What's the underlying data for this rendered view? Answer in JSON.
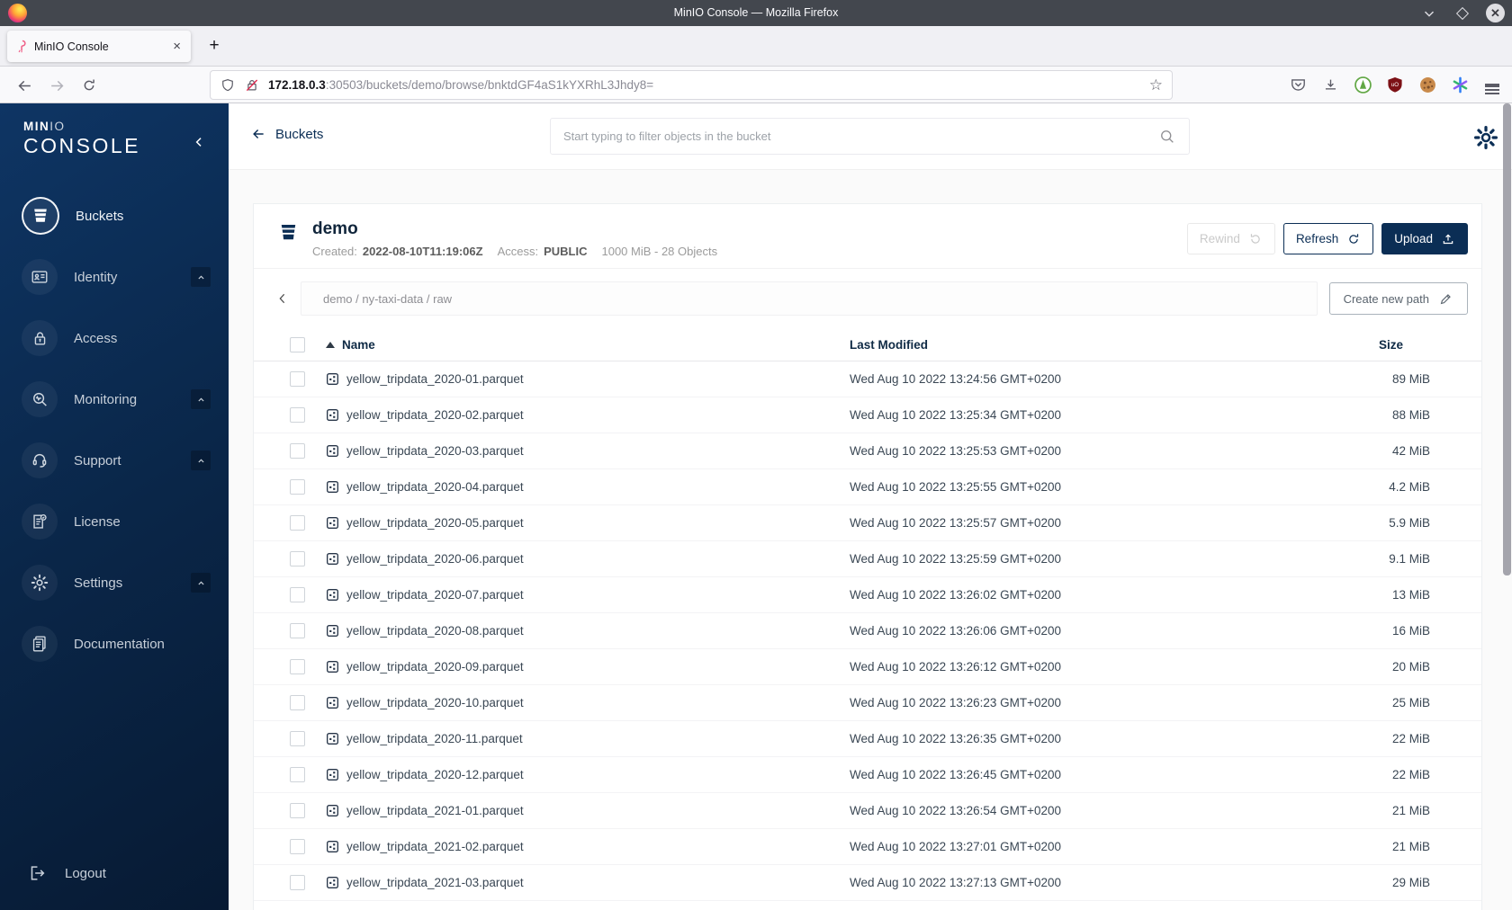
{
  "titlebar": {
    "title": "MinIO Console — Mozilla Firefox"
  },
  "tabs": {
    "active_tab": "MinIO Console",
    "close_glyph": "×",
    "new_tab_label": "+"
  },
  "urlbar": {
    "host": "172.18.0.3",
    "path": ":30503/buckets/demo/browse/bnktdGF4aS1kYXRhL3Jhdy8=",
    "star_glyph": "☆"
  },
  "sidebar": {
    "brand_min": "MIN",
    "brand_io": "IO",
    "brand_console": "CONSOLE",
    "items": [
      {
        "label": "Buckets",
        "icon": "bucket",
        "active": true,
        "expandable": false
      },
      {
        "label": "Identity",
        "icon": "identity",
        "active": false,
        "expandable": true
      },
      {
        "label": "Access",
        "icon": "access",
        "active": false,
        "expandable": false
      },
      {
        "label": "Monitoring",
        "icon": "monitoring",
        "active": false,
        "expandable": true
      },
      {
        "label": "Support",
        "icon": "support",
        "active": false,
        "expandable": true
      },
      {
        "label": "License",
        "icon": "license",
        "active": false,
        "expandable": false
      },
      {
        "label": "Settings",
        "icon": "settings",
        "active": false,
        "expandable": true
      },
      {
        "label": "Documentation",
        "icon": "documentation",
        "active": false,
        "expandable": false
      }
    ],
    "logout": {
      "label": "Logout"
    }
  },
  "topbar": {
    "back_label": "Buckets",
    "search_placeholder": "Start typing to filter objects in the bucket"
  },
  "bucket_header": {
    "name": "demo",
    "created_label": "Created:",
    "created": "2022-08-10T11:19:06Z",
    "access_label": "Access:",
    "access": "PUBLIC",
    "usage": "1000 MiB - 28 Objects",
    "buttons": {
      "rewind": "Rewind",
      "refresh": "Refresh",
      "upload": "Upload"
    }
  },
  "browse": {
    "breadcrumb": "demo / ny-taxi-data / raw",
    "create_path": "Create new path"
  },
  "objects": {
    "columns": {
      "name": "Name",
      "modified": "Last Modified",
      "size": "Size"
    },
    "rows": [
      {
        "name": "yellow_tripdata_2020-01.parquet",
        "modified": "Wed Aug 10 2022 13:24:56 GMT+0200",
        "size": "89 MiB"
      },
      {
        "name": "yellow_tripdata_2020-02.parquet",
        "modified": "Wed Aug 10 2022 13:25:34 GMT+0200",
        "size": "88 MiB"
      },
      {
        "name": "yellow_tripdata_2020-03.parquet",
        "modified": "Wed Aug 10 2022 13:25:53 GMT+0200",
        "size": "42 MiB"
      },
      {
        "name": "yellow_tripdata_2020-04.parquet",
        "modified": "Wed Aug 10 2022 13:25:55 GMT+0200",
        "size": "4.2 MiB"
      },
      {
        "name": "yellow_tripdata_2020-05.parquet",
        "modified": "Wed Aug 10 2022 13:25:57 GMT+0200",
        "size": "5.9 MiB"
      },
      {
        "name": "yellow_tripdata_2020-06.parquet",
        "modified": "Wed Aug 10 2022 13:25:59 GMT+0200",
        "size": "9.1 MiB"
      },
      {
        "name": "yellow_tripdata_2020-07.parquet",
        "modified": "Wed Aug 10 2022 13:26:02 GMT+0200",
        "size": "13 MiB"
      },
      {
        "name": "yellow_tripdata_2020-08.parquet",
        "modified": "Wed Aug 10 2022 13:26:06 GMT+0200",
        "size": "16 MiB"
      },
      {
        "name": "yellow_tripdata_2020-09.parquet",
        "modified": "Wed Aug 10 2022 13:26:12 GMT+0200",
        "size": "20 MiB"
      },
      {
        "name": "yellow_tripdata_2020-10.parquet",
        "modified": "Wed Aug 10 2022 13:26:23 GMT+0200",
        "size": "25 MiB"
      },
      {
        "name": "yellow_tripdata_2020-11.parquet",
        "modified": "Wed Aug 10 2022 13:26:35 GMT+0200",
        "size": "22 MiB"
      },
      {
        "name": "yellow_tripdata_2020-12.parquet",
        "modified": "Wed Aug 10 2022 13:26:45 GMT+0200",
        "size": "22 MiB"
      },
      {
        "name": "yellow_tripdata_2021-01.parquet",
        "modified": "Wed Aug 10 2022 13:26:54 GMT+0200",
        "size": "21 MiB"
      },
      {
        "name": "yellow_tripdata_2021-02.parquet",
        "modified": "Wed Aug 10 2022 13:27:01 GMT+0200",
        "size": "21 MiB"
      },
      {
        "name": "yellow_tripdata_2021-03.parquet",
        "modified": "Wed Aug 10 2022 13:27:13 GMT+0200",
        "size": "29 MiB"
      }
    ]
  },
  "colors": {
    "accent_navy": "#0b2e55",
    "sidebar_top": "#0e3564",
    "sidebar_bottom": "#071a33",
    "chrome_dark": "#43474e"
  }
}
